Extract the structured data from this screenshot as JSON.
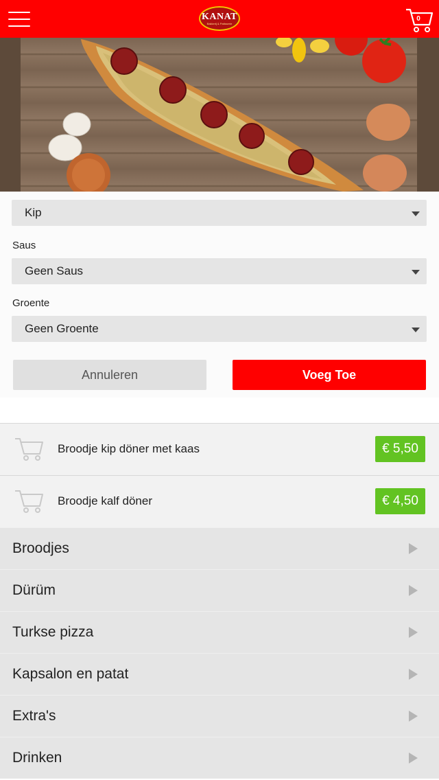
{
  "header": {
    "menu_icon": "hamburger-icon",
    "logo_text": "KANAT",
    "logo_subtext": "Bakkerij & Patisserie",
    "cart_icon": "shopping-cart-icon",
    "cart_count": "0",
    "background_color": "#ff0000"
  },
  "hero": {
    "image": "turkish-pizza-pide-photo"
  },
  "form": {
    "fields": [
      {
        "label": "",
        "value": "Kip"
      },
      {
        "label": "Saus",
        "value": "Geen Saus"
      },
      {
        "label": "Groente",
        "value": "Geen Groente"
      }
    ],
    "cancel_label": "Annuleren",
    "add_label": "Voeg Toe"
  },
  "products": [
    {
      "name": "Broodje kip döner met kaas",
      "price": "€ 5,50",
      "icon": "cart-icon"
    },
    {
      "name": "Broodje kalf döner",
      "price": "€ 4,50",
      "icon": "cart-icon"
    }
  ],
  "categories": [
    {
      "label": "Broodjes"
    },
    {
      "label": "Dürüm"
    },
    {
      "label": "Turkse pizza"
    },
    {
      "label": "Kapsalon en patat"
    },
    {
      "label": "Extra's"
    },
    {
      "label": "Drinken"
    }
  ],
  "colors": {
    "primary": "#ff0000",
    "price_badge": "#62c322",
    "category_bg": "#e5e5e5"
  }
}
